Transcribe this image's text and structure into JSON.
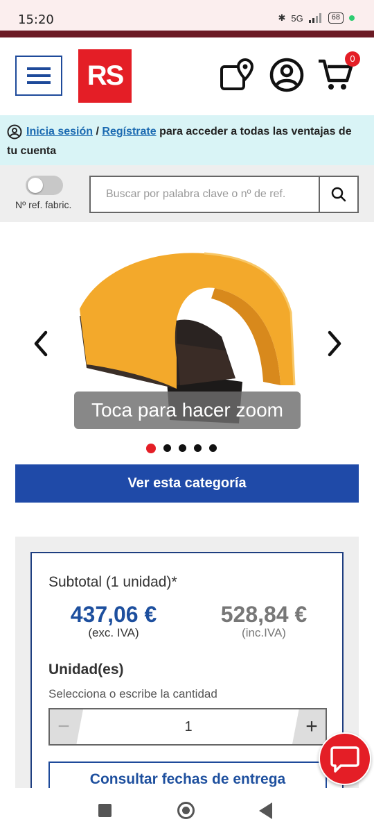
{
  "status_bar": {
    "time": "15:20",
    "network": "5G",
    "battery": "68"
  },
  "header": {
    "logo_text": "RS",
    "cart_count": "0"
  },
  "login_banner": {
    "login_link": "Inicia sesión",
    "separator": "/",
    "register_link": "Regístrate",
    "message": "para acceder a todas las ventajas de tu cuenta"
  },
  "search": {
    "toggle_label": "Nº ref. fabric.",
    "toggle_on": false,
    "placeholder": "Buscar por palabra clave o nº de ref."
  },
  "carousel": {
    "zoom_hint": "Toca para hacer zoom",
    "image_count": 5,
    "active_index": 0
  },
  "category_button": "Ver esta categoría",
  "pricing": {
    "subtotal_label": "Subtotal (1 unidad)*",
    "price_excl": "437,06 €",
    "excl_label": "(exc. IVA)",
    "price_incl": "528,84 €",
    "incl_label": "(inc.IVA)"
  },
  "quantity": {
    "label": "Unidad(es)",
    "help": "Selecciona o escribe la cantidad",
    "minus": "−",
    "value": "1",
    "plus": "+"
  },
  "delivery_button": "Consultar fechas de entrega",
  "colors": {
    "brand_red": "#e41e26",
    "primary_blue": "#1f4aa8",
    "banner_bg": "#d9f4f6",
    "header_stripe": "#6b1a24"
  }
}
